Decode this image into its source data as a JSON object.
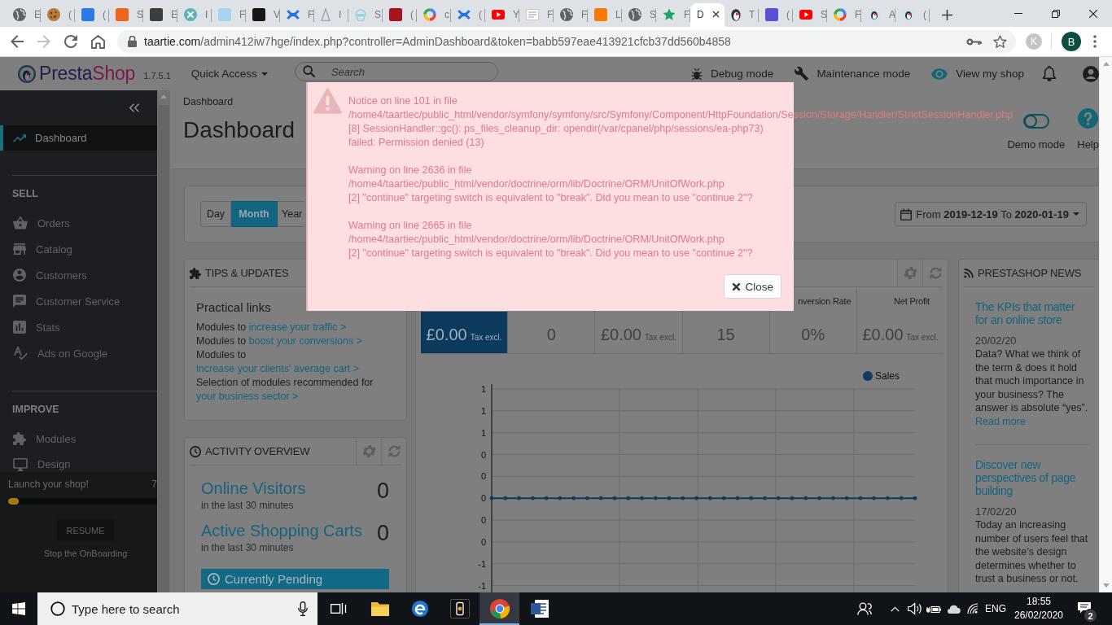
{
  "browser": {
    "tabs": [
      {
        "title": "E",
        "selected": false
      },
      {
        "title": "(",
        "selected": false
      },
      {
        "title": "(",
        "selected": false
      },
      {
        "title": "S",
        "selected": false
      },
      {
        "title": "E",
        "selected": false
      },
      {
        "title": "I",
        "selected": false
      },
      {
        "title": "F",
        "selected": false
      },
      {
        "title": "V",
        "selected": false
      },
      {
        "title": "F",
        "selected": false
      },
      {
        "title": "I",
        "selected": false
      },
      {
        "title": "S",
        "selected": false
      },
      {
        "title": "(",
        "selected": false
      },
      {
        "title": "c",
        "selected": false
      },
      {
        "title": "(",
        "selected": false
      },
      {
        "title": "Y",
        "selected": false
      },
      {
        "title": "F",
        "selected": false
      },
      {
        "title": "F",
        "selected": false
      },
      {
        "title": "L",
        "selected": false
      },
      {
        "title": "S",
        "selected": false
      },
      {
        "title": "F",
        "selected": false
      },
      {
        "title": "D",
        "selected": true
      },
      {
        "title": "T",
        "selected": false
      },
      {
        "title": "(",
        "selected": false
      },
      {
        "title": "S",
        "selected": false
      },
      {
        "title": "F",
        "selected": false
      },
      {
        "title": "A",
        "selected": false
      },
      {
        "title": "(",
        "selected": false
      }
    ],
    "address": {
      "host": "taartie.com",
      "rest": "/admin412iw7hge/index.php?controller=AdminDashboard&token=babb597eae413921cfcb37dd560b4858"
    },
    "profiles": [
      {
        "letter": "K",
        "color": "#c2c4c7"
      },
      {
        "letter": "B",
        "color": "#0c4f40"
      }
    ]
  },
  "header": {
    "logo": [
      "Presta",
      "Shop"
    ],
    "version": "1.7.5.1",
    "quick_access": "Quick Access",
    "search": {
      "placeholder": "Search"
    },
    "links": [
      "Debug mode",
      "Maintenance mode",
      "View my shop"
    ]
  },
  "sidebar": {
    "items": [
      {
        "label": "Dashboard",
        "selected": true
      }
    ],
    "sections": [
      {
        "title": "SELL",
        "items": [
          {
            "label": "Orders",
            "selected": false
          },
          {
            "label": "Catalog",
            "selected": false
          },
          {
            "label": "Customers",
            "selected": false
          },
          {
            "label": "Customer Service",
            "selected": false
          },
          {
            "label": "Stats",
            "selected": false
          },
          {
            "label": "Ads on Google",
            "selected": false
          }
        ]
      },
      {
        "title": "IMPROVE",
        "items": [
          {
            "label": "Modules",
            "selected": false
          },
          {
            "label": "Design",
            "selected": false
          }
        ]
      }
    ],
    "onboarding": {
      "title": "Launch your shop!",
      "percent": "7",
      "level": 0.07,
      "button": "RESUME",
      "link": "Stop the OnBoarding"
    }
  },
  "page": {
    "breadcrumb": "Dashboard",
    "title": "Dashboard",
    "demo_mode": {
      "label": "Demo mode",
      "on": false
    },
    "help": "Help"
  },
  "period": {
    "buttons": [
      {
        "label": "Day",
        "selected": false
      },
      {
        "label": "Month",
        "selected": true
      },
      {
        "label": "Year",
        "selected": false
      }
    ],
    "range": "From **2019-12-19** To **2020-01-19**"
  },
  "tips": {
    "title": "TIPS & UPDATES",
    "heading": "Practical links",
    "lines": [
      {
        "text": "Modules to",
        "link": "increase your traffic >"
      },
      {
        "text": "Modules to",
        "link": "boost your conversions >"
      },
      {
        "text": "Modules to",
        "link": "increase your clients' average cart >"
      },
      {
        "text": "Selection of modules recommended for",
        "link": "your business sector >"
      }
    ]
  },
  "activity": {
    "title": "ACTIVITY OVERVIEW",
    "metrics": [
      {
        "label": "Online Visitors",
        "value": "0",
        "note": "in the last 30 minutes"
      },
      {
        "label": "Active Shopping Carts",
        "value": "0",
        "note": "in the last 30 minutes"
      }
    ],
    "pending": "Currently Pending"
  },
  "dashboard": {
    "kpis": [
      {
        "value": "£0.00",
        "unit": "Tax excl.",
        "selected": true
      },
      {
        "value": "0",
        "selected": false
      },
      {
        "value": "£0.00",
        "unit": "Tax excl.",
        "selected": false
      },
      {
        "value": "15",
        "selected": false
      },
      {
        "label": "nversion Rate",
        "value": "0%",
        "selected": false
      },
      {
        "label": "Net Profit",
        "value": "£0.00",
        "unit": "Tax excl.",
        "selected": false
      }
    ],
    "chart_data": {
      "type": "line",
      "grid": true,
      "series": [
        {
          "name": "Sales",
          "color": "#0e3d61",
          "values": [
            0,
            0,
            0,
            0,
            0,
            0,
            0,
            0,
            0,
            0,
            0,
            0,
            0,
            0,
            0,
            0,
            0,
            0,
            0,
            0,
            0,
            0,
            0,
            0,
            0,
            0,
            0,
            0,
            0,
            0,
            0,
            0
          ]
        }
      ],
      "ylim": [
        -0.87,
        1
      ],
      "yticks": [
        {
          "value": 1,
          "label": "1"
        },
        {
          "value": 0.8,
          "label": "1"
        },
        {
          "value": 0.6,
          "label": "1"
        },
        {
          "value": 0.4,
          "label": "0"
        },
        {
          "value": 0.2,
          "label": "0"
        },
        {
          "value": 0,
          "label": "0"
        },
        {
          "value": -0.2,
          "label": "0"
        },
        {
          "value": -0.4,
          "label": "0"
        },
        {
          "value": -0.6,
          "label": "-1"
        },
        {
          "value": -0.8,
          "label": "-1"
        }
      ]
    }
  },
  "news": {
    "title": "PRESTASHOP NEWS",
    "articles": [
      {
        "title": "The KPIs that matter for an online store",
        "date": "20/02/20",
        "summary": "Data? What we think of the term & does it hold that much importance in your business? The answer is absolute “yes”.",
        "link": "Read more"
      },
      {
        "title": "Discover new perspectives of page building",
        "date": "17/02/20",
        "summary": "Today an increasing number of users feel that the website’s design determines whether to trust a business or not."
      }
    ]
  },
  "modal": {
    "messages": [
      {
        "heading": "Notice on line 101 in file",
        "file": "/home4/taartiec/public_html/vendor/symfony/symfony/src/Symfony/Component/HttpFoundation/Session/Storage/Handler/StrictSessionHandler.php",
        "detail": "[8] SessionHandler::gc(): ps_files_cleanup_dir: opendir(/var/cpanel/php/sessions/ea-php73) failed: Permission denied (13)"
      },
      {
        "heading": "Warning on line 2636 in file",
        "file": "/home4/taartiec/public_html/vendor/doctrine/orm/lib/Doctrine/ORM/UnitOfWork.php",
        "detail": "[2] \"continue\" targeting switch is equivalent to \"break\". Did you mean to use \"continue 2\"?"
      },
      {
        "heading": "Warning on line 2665 in file",
        "file": "/home4/taartiec/public_html/vendor/doctrine/orm/lib/Doctrine/ORM/UnitOfWork.php",
        "detail": "[2] \"continue\" targeting switch is equivalent to \"break\". Did you mean to use \"continue 2\"?"
      }
    ],
    "button": "Close"
  },
  "taskbar": {
    "search": {
      "placeholder": "Type here to search"
    },
    "apps": [
      {
        "selected": false
      },
      {
        "selected": false
      },
      {
        "selected": false
      },
      {
        "selected": true
      },
      {
        "selected": false
      }
    ],
    "language": "ENG",
    "time": "18:55",
    "date": "26/02/2020",
    "notifications": "2"
  }
}
